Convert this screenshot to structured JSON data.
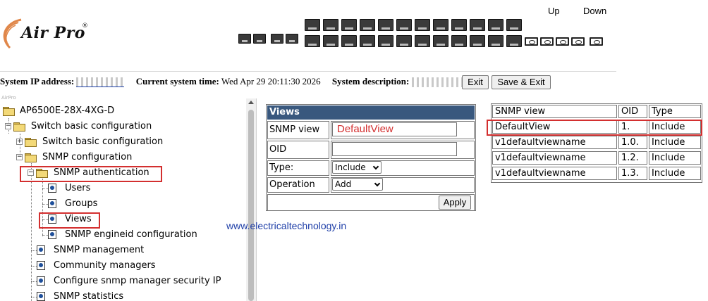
{
  "header": {
    "brand": "Air Pro",
    "registered": "®",
    "legend_up": "Up",
    "legend_down": "Down"
  },
  "status": {
    "ip_label": "System IP address:",
    "ip_value_hint": "10.",
    "time_label": "Current system time:",
    "time_value": "Wed Apr 29 20:11:30 2026",
    "desc_label": "System description:",
    "exit_label": "Exit",
    "save_exit_label": "Save & Exit"
  },
  "tree": {
    "tiny_logo": "AirPro",
    "items": [
      {
        "label": "AP6500E-28X-4XG-D"
      },
      {
        "label": "Switch basic configuration"
      },
      {
        "label": "Switch basic configuration"
      },
      {
        "label": "SNMP configuration"
      },
      {
        "label": "SNMP authentication"
      },
      {
        "label": "Users"
      },
      {
        "label": "Groups"
      },
      {
        "label": "Views"
      },
      {
        "label": "SNMP engineid configuration"
      },
      {
        "label": "SNMP management"
      },
      {
        "label": "Community managers"
      },
      {
        "label": "Configure snmp manager security IP"
      },
      {
        "label": "SNMP statistics"
      }
    ]
  },
  "form": {
    "title": "Views",
    "snmp_view_label": "SNMP view",
    "snmp_view_value": "DefaultView",
    "oid_label": "OID",
    "oid_value": "",
    "type_label": "Type:",
    "type_selected": "Include",
    "operation_label": "Operation",
    "operation_selected": "Add",
    "apply_label": "Apply"
  },
  "watermark": "www.electricaltechnology.in",
  "views_table": {
    "headers": [
      "SNMP view",
      "OID",
      "Type"
    ],
    "rows": [
      [
        "DefaultView",
        "1.",
        "Include"
      ],
      [
        "v1defaultviewname",
        "1.0.",
        "Include"
      ],
      [
        "v1defaultviewname",
        "1.2.",
        "Include"
      ],
      [
        "v1defaultviewname",
        "1.3.",
        "Include"
      ]
    ]
  },
  "colors": {
    "form_header": "#39587e",
    "highlight_box": "#d32f2f",
    "input_text": "#d32f2f",
    "watermark": "#1f3fa8"
  }
}
